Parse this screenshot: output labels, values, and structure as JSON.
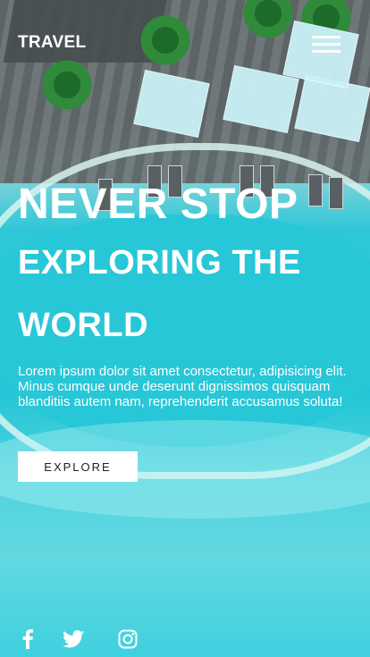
{
  "header": {
    "logo": "TRAVEL",
    "menu_icon": "hamburger-menu-icon"
  },
  "hero": {
    "headline_line1": "NEVER STOP",
    "headline_line2": "EXPLORING THE",
    "headline_line3": "WORLD",
    "description": "Lorem ipsum dolor sit amet consectetur, adipisicing elit. Minus cumque unde deserunt dignissimos quisquam blanditiis autem nam, reprehenderit accusamus soluta!",
    "cta_label": "EXPLORE"
  },
  "social": {
    "icons": [
      "facebook-icon",
      "twitter-icon",
      "instagram-icon"
    ]
  },
  "colors": {
    "text": "#ffffff",
    "button_bg": "#ffffff",
    "button_text": "#222222",
    "water": "#27c7d7"
  }
}
